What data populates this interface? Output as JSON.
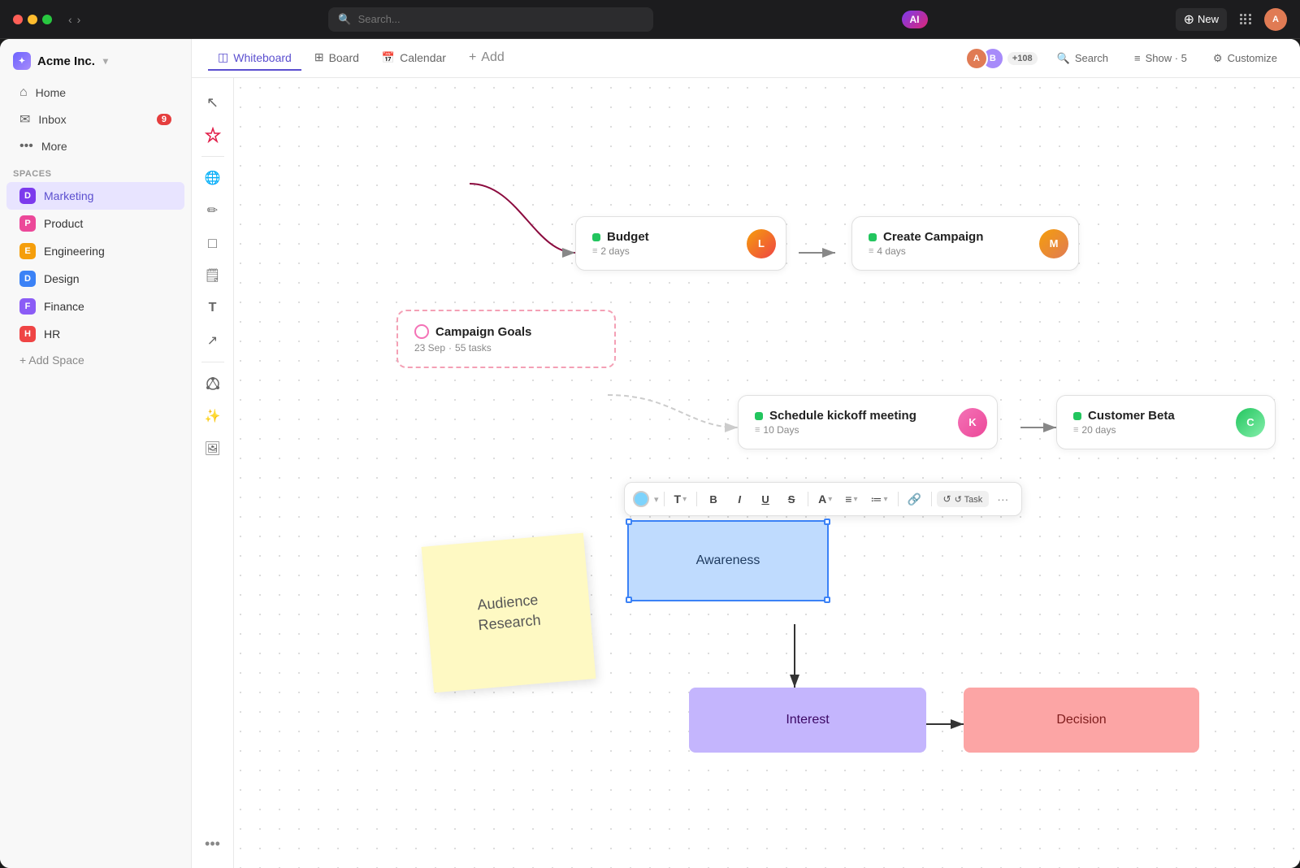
{
  "topbar": {
    "search_placeholder": "Search...",
    "ai_label": "AI",
    "new_label": "New"
  },
  "sidebar": {
    "logo": "Acme Inc.",
    "nav": [
      {
        "id": "home",
        "label": "Home",
        "icon": "⌂"
      },
      {
        "id": "inbox",
        "label": "Inbox",
        "icon": "✉",
        "badge": "9"
      },
      {
        "id": "more",
        "label": "More",
        "icon": "···"
      }
    ],
    "spaces_label": "Spaces",
    "spaces": [
      {
        "id": "marketing",
        "label": "Marketing",
        "letter": "D",
        "color": "#7c3aed",
        "active": true
      },
      {
        "id": "product",
        "label": "Product",
        "letter": "P",
        "color": "#ec4899"
      },
      {
        "id": "engineering",
        "label": "Engineering",
        "letter": "E",
        "color": "#f59e0b"
      },
      {
        "id": "design",
        "label": "Design",
        "letter": "D",
        "color": "#3b82f6"
      },
      {
        "id": "finance",
        "label": "Finance",
        "letter": "F",
        "color": "#8b5cf6"
      },
      {
        "id": "hr",
        "label": "HR",
        "letter": "H",
        "color": "#ef4444"
      }
    ],
    "add_space_label": "+ Add Space"
  },
  "tabs": [
    {
      "id": "whiteboard",
      "label": "Whiteboard",
      "icon": "◫",
      "active": true
    },
    {
      "id": "board",
      "label": "Board",
      "icon": "⊞"
    },
    {
      "id": "calendar",
      "label": "Calendar",
      "icon": "📅"
    },
    {
      "id": "add",
      "label": "Add",
      "icon": "+"
    }
  ],
  "tab_actions": {
    "search_label": "Search",
    "show_label": "Show · 5",
    "customize_label": "Customize",
    "avatars_count": "+108"
  },
  "toolbar_tools": [
    {
      "id": "pointer",
      "icon": "↖",
      "active": false
    },
    {
      "id": "smart",
      "icon": "✦"
    },
    {
      "id": "globe",
      "icon": "🌐"
    },
    {
      "id": "pen",
      "icon": "✏"
    },
    {
      "id": "shape",
      "icon": "□"
    },
    {
      "id": "note",
      "icon": "🗒"
    },
    {
      "id": "text",
      "icon": "T"
    },
    {
      "id": "connector",
      "icon": "↗"
    },
    {
      "id": "network",
      "icon": "⬡"
    },
    {
      "id": "sparkle",
      "icon": "✨"
    },
    {
      "id": "image",
      "icon": "🖼"
    },
    {
      "id": "more-tools",
      "icon": "···"
    }
  ],
  "cards": {
    "campaign_goals": {
      "title": "Campaign Goals",
      "date": "23 Sep",
      "tasks": "55 tasks"
    },
    "budget": {
      "title": "Budget",
      "days": "2 days"
    },
    "create_campaign": {
      "title": "Create Campaign",
      "days": "4 days"
    },
    "schedule_kickoff": {
      "title": "Schedule kickoff meeting",
      "days": "10 Days"
    },
    "customer_beta": {
      "title": "Customer Beta",
      "days": "20 days"
    }
  },
  "flow_nodes": {
    "audience_research": "Audience\nResearch",
    "awareness": "Awareness",
    "interest": "Interest",
    "decision": "Decision"
  },
  "format_toolbar": {
    "color_label": "color",
    "text_size_label": "T",
    "bold_label": "B",
    "italic_label": "I",
    "underline_label": "U",
    "strike_label": "S",
    "font_label": "A",
    "align_label": "≡",
    "list_label": "≔",
    "link_label": "🔗",
    "task_label": "↺ Task",
    "more_label": "···"
  }
}
